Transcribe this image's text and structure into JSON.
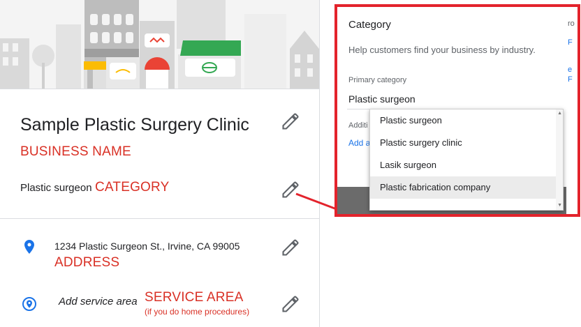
{
  "business": {
    "name": "Sample Plastic Surgery Clinic",
    "name_annotation": "BUSINESS NAME",
    "category": "Plastic surgeon",
    "category_annotation": "CATEGORY",
    "address": "1234 Plastic Surgeon St., Irvine, CA 99005",
    "address_annotation": "ADDRESS",
    "service_area": "Add service area",
    "service_area_annotation": "SERVICE AREA",
    "service_area_note": "(if you do home procedures)"
  },
  "dialog": {
    "title": "Category",
    "help_text": "Help customers find your business by industry.",
    "primary_label": "Primary category",
    "primary_value": "Plastic surgeon",
    "additional_label": "Additi",
    "add_link": "Add a"
  },
  "dropdown": {
    "options": [
      "Plastic surgeon",
      "Plastic surgery clinic",
      "Lasik surgeon",
      "Plastic fabrication company"
    ],
    "highlighted_index": 3
  },
  "colors": {
    "annotation_red": "#d93025",
    "frame_red": "#e3232c",
    "link_blue": "#1a73e8",
    "hero_green": "#34a853",
    "hero_red": "#ea4335",
    "hero_yellow": "#fbbc04"
  }
}
